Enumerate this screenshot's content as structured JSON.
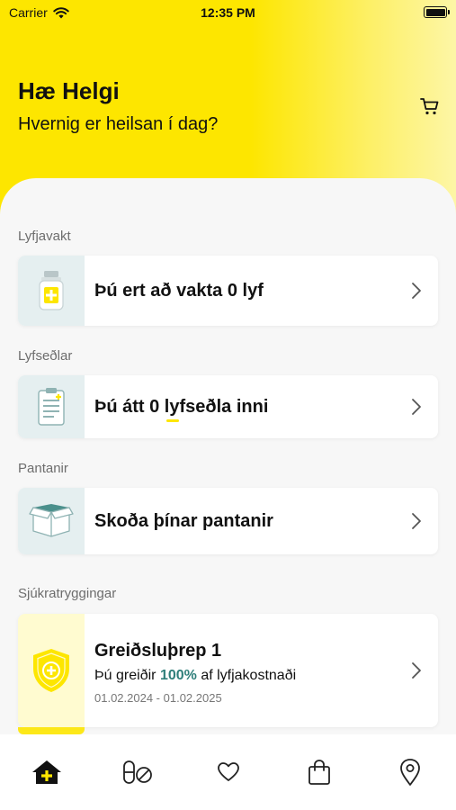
{
  "status": {
    "carrier": "Carrier",
    "time": "12:35 PM"
  },
  "header": {
    "greeting": "Hæ Helgi",
    "subtitle": "Hvernig er heilsan í dag?"
  },
  "sections": {
    "lyfjavakt": {
      "label": "Lyfjavakt",
      "card_text": "Þú ert að vakta 0 lyf"
    },
    "lyfsedlar": {
      "label": "Lyfseðlar",
      "card_text": "Þú átt 0 lyfseðla inni"
    },
    "pantanir": {
      "label": "Pantanir",
      "card_text": "Skoða þínar pantanir"
    },
    "sjukratryggingar": {
      "label": "Sjúkratryggingar",
      "card_title": "Greiðsluþrep 1",
      "line_prefix": "Þú greiðir",
      "percent": "100%",
      "line_suffix": "af lyfjakostnaði",
      "date_range": "01.02.2024 - 01.02.2025"
    }
  },
  "tabs": [
    {
      "name": "home",
      "icon": "home-plus-icon",
      "active": true
    },
    {
      "name": "medicines",
      "icon": "pills-icon"
    },
    {
      "name": "favorites",
      "icon": "heart-icon"
    },
    {
      "name": "shop",
      "icon": "shopping-bag-icon"
    },
    {
      "name": "locations",
      "icon": "map-pin-icon"
    }
  ],
  "colors": {
    "brand_yellow": "#fde600",
    "accent_teal": "#2f7f7a",
    "icon_bg": "#e5eff0"
  }
}
